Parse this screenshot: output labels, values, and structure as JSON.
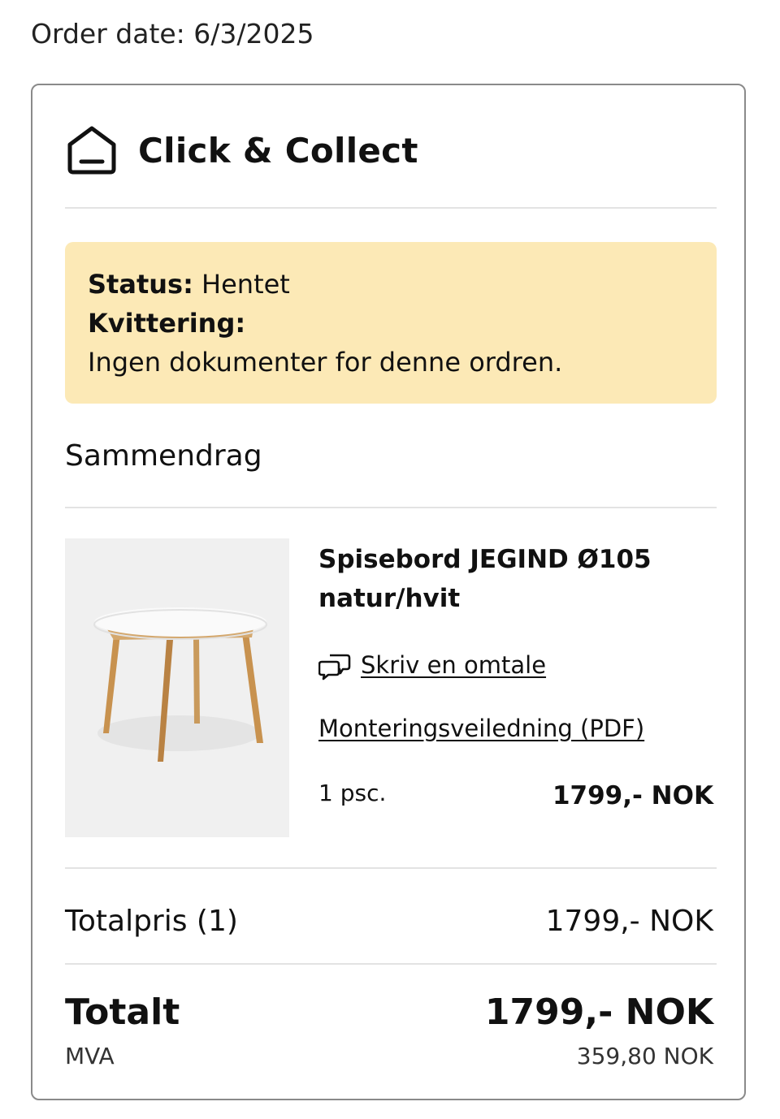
{
  "order_date": "Order date: 6/3/2025",
  "header": {
    "icon": "house-icon",
    "title": "Click & Collect"
  },
  "status_box": {
    "status_label": "Status:",
    "status_value": "Hentet",
    "receipt_label": "Kvittering:",
    "receipt_message": "Ingen dokumenter for denne ordren."
  },
  "summary": {
    "title": "Sammendrag",
    "item": {
      "name": "Spisebord JEGIND Ø105 natur/hvit",
      "review_icon": "speech-bubbles-icon",
      "review_link": "Skriv en omtale",
      "manual_link": "Monteringsveiledning (PDF)",
      "quantity": "1 psc.",
      "price": "1799,- NOK"
    }
  },
  "totals": {
    "totalpris_label": "Totalpris (1)",
    "totalpris_value": "1799,- NOK",
    "total_label": "Totalt",
    "total_value": "1799,- NOK",
    "vat_label": "MVA",
    "vat_value": "359,80 NOK"
  },
  "colors": {
    "status_bg": "#fce9b6",
    "border": "#8a8a8a",
    "divider": "#e3e3e3"
  }
}
